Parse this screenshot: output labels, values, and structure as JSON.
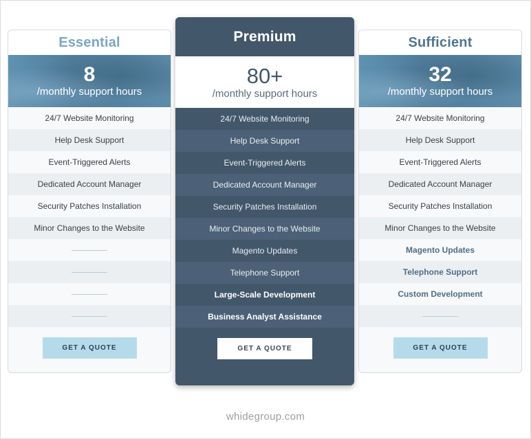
{
  "plans": [
    {
      "name": "Essential",
      "hours": "8",
      "hours_label": "/monthly support hours",
      "features": [
        {
          "label": "24/7 Website Monitoring",
          "included": true,
          "highlight": false
        },
        {
          "label": "Help Desk Support",
          "included": true,
          "highlight": false
        },
        {
          "label": "Event-Triggered Alerts",
          "included": true,
          "highlight": false
        },
        {
          "label": "Dedicated Account Manager",
          "included": true,
          "highlight": false
        },
        {
          "label": "Security Patches Installation",
          "included": true,
          "highlight": false
        },
        {
          "label": "Minor Changes to the Website",
          "included": true,
          "highlight": false
        },
        {
          "label": "",
          "included": false,
          "highlight": false
        },
        {
          "label": "",
          "included": false,
          "highlight": false
        },
        {
          "label": "",
          "included": false,
          "highlight": false
        },
        {
          "label": "",
          "included": false,
          "highlight": false
        }
      ],
      "cta": "GET A QUOTE"
    },
    {
      "name": "Premium",
      "hours": "80+",
      "hours_label": "/monthly support hours",
      "features": [
        {
          "label": "24/7 Website Monitoring",
          "included": true,
          "highlight": false
        },
        {
          "label": "Help Desk Support",
          "included": true,
          "highlight": false
        },
        {
          "label": "Event-Triggered Alerts",
          "included": true,
          "highlight": false
        },
        {
          "label": "Dedicated Account Manager",
          "included": true,
          "highlight": false
        },
        {
          "label": "Security Patches Installation",
          "included": true,
          "highlight": false
        },
        {
          "label": "Minor Changes to the Website",
          "included": true,
          "highlight": false
        },
        {
          "label": "Magento Updates",
          "included": true,
          "highlight": false
        },
        {
          "label": "Telephone Support",
          "included": true,
          "highlight": false
        },
        {
          "label": "Large-Scale Development",
          "included": true,
          "highlight": true
        },
        {
          "label": "Business Analyst Assistance",
          "included": true,
          "highlight": true
        }
      ],
      "cta": "GET A QUOTE"
    },
    {
      "name": "Sufficient",
      "hours": "32",
      "hours_label": "/monthly support hours",
      "features": [
        {
          "label": "24/7 Website Monitoring",
          "included": true,
          "highlight": false
        },
        {
          "label": "Help Desk Support",
          "included": true,
          "highlight": false
        },
        {
          "label": "Event-Triggered Alerts",
          "included": true,
          "highlight": false
        },
        {
          "label": "Dedicated Account Manager",
          "included": true,
          "highlight": false
        },
        {
          "label": "Security Patches Installation",
          "included": true,
          "highlight": false
        },
        {
          "label": "Minor Changes to the Website",
          "included": true,
          "highlight": false
        },
        {
          "label": "Magento Updates",
          "included": true,
          "highlight": true
        },
        {
          "label": "Telephone Support",
          "included": true,
          "highlight": true
        },
        {
          "label": "Custom Development",
          "included": true,
          "highlight": true
        },
        {
          "label": "",
          "included": false,
          "highlight": false
        }
      ],
      "cta": "GET A QUOTE"
    }
  ],
  "footer": {
    "text": "whidegroup.com"
  },
  "colors": {
    "premium_bg": "#43576b",
    "essential_title": "#7aa6c2",
    "sufficient_title": "#4f7592",
    "quote_button": "#b5dbea"
  }
}
